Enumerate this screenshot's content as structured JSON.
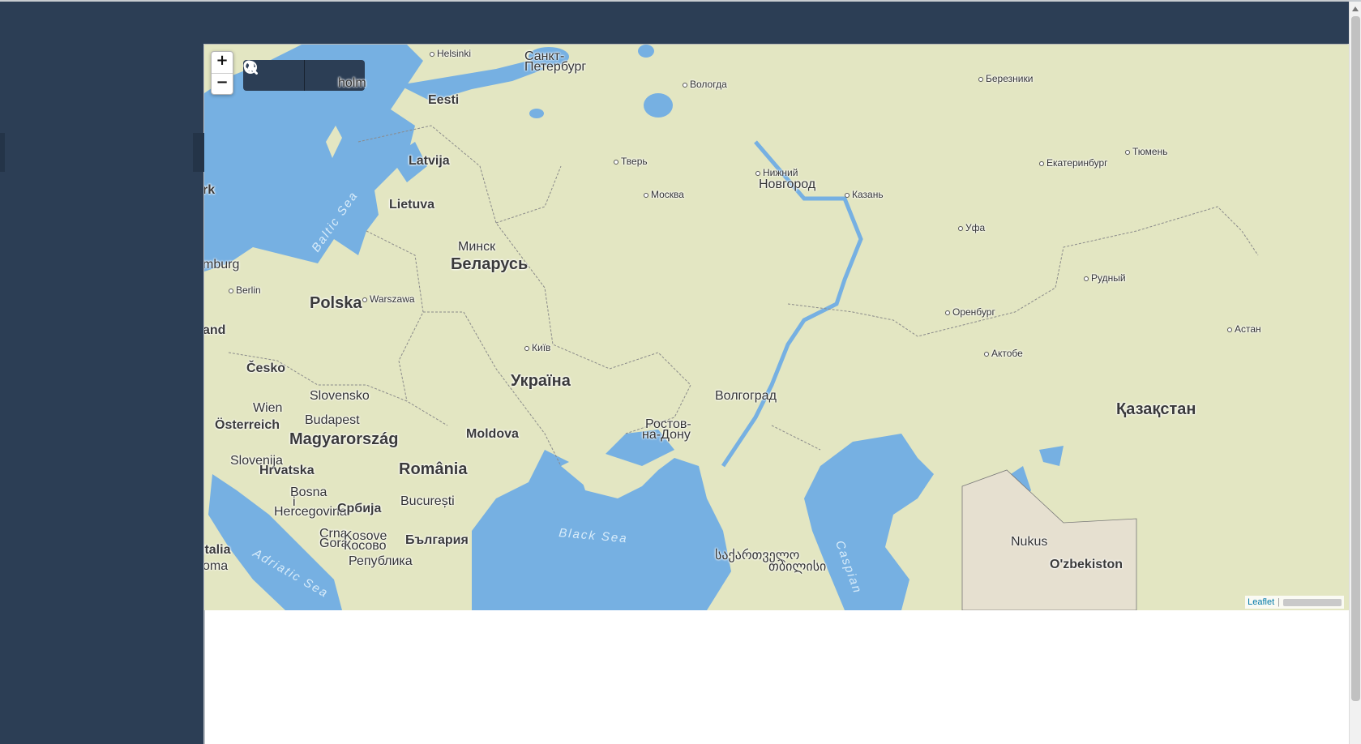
{
  "zoom": {
    "in_label": "+",
    "out_label": "−"
  },
  "toolbar": {
    "globe_icon": "globe-icon",
    "search_icon": "search-icon"
  },
  "attribution": {
    "link": "Leaflet",
    "separator": "|"
  },
  "colors": {
    "chrome": "#2c3e55",
    "water": "#76b0e2",
    "land": "#e3e6c2"
  },
  "map_labels": [
    {
      "text": "Helsinki",
      "kind": "city"
    },
    {
      "text": "Санкт-",
      "kind": "plain"
    },
    {
      "text": "Петербург",
      "kind": "plain"
    },
    {
      "text": "Вологда",
      "kind": "city"
    },
    {
      "text": "Березники",
      "kind": "city"
    },
    {
      "text": "holm",
      "kind": "plain"
    },
    {
      "text": "Eesti",
      "kind": "country"
    },
    {
      "text": "Latvija",
      "kind": "country"
    },
    {
      "text": "Lietuva",
      "kind": "country"
    },
    {
      "text": "rk",
      "kind": "country"
    },
    {
      "text": "mburg",
      "kind": "plain"
    },
    {
      "text": "Berlin",
      "kind": "city"
    },
    {
      "text": "Polska",
      "kind": "country"
    },
    {
      "text": "Warszawa",
      "kind": "city"
    },
    {
      "text": "Минск",
      "kind": "plain"
    },
    {
      "text": "Беларусь",
      "kind": "country"
    },
    {
      "text": "Тверь",
      "kind": "city"
    },
    {
      "text": "Москва",
      "kind": "city"
    },
    {
      "text": "Нижний",
      "kind": "city"
    },
    {
      "text": "Новгород",
      "kind": "plain"
    },
    {
      "text": "Казань",
      "kind": "city"
    },
    {
      "text": "Екатеринбург",
      "kind": "city"
    },
    {
      "text": "Тюмень",
      "kind": "city"
    },
    {
      "text": "Уфа",
      "kind": "city"
    },
    {
      "text": "Рудный",
      "kind": "city"
    },
    {
      "text": "Оренбург",
      "kind": "city"
    },
    {
      "text": "Астан",
      "kind": "city"
    },
    {
      "text": "Актобе",
      "kind": "city"
    },
    {
      "text": "and",
      "kind": "country"
    },
    {
      "text": "Česko",
      "kind": "country"
    },
    {
      "text": "Київ",
      "kind": "city"
    },
    {
      "text": "Україна",
      "kind": "country"
    },
    {
      "text": "Slovensko",
      "kind": "plain"
    },
    {
      "text": "Wien",
      "kind": "plain"
    },
    {
      "text": "Budapest",
      "kind": "plain"
    },
    {
      "text": "Österreich",
      "kind": "country"
    },
    {
      "text": "Magyarország",
      "kind": "country"
    },
    {
      "text": "Moldova",
      "kind": "country"
    },
    {
      "text": "Волгоград",
      "kind": "plain"
    },
    {
      "text": "Ростов-",
      "kind": "plain"
    },
    {
      "text": "на-Дону",
      "kind": "plain"
    },
    {
      "text": "Қазақстан",
      "kind": "country"
    },
    {
      "text": "Slovenija",
      "kind": "plain"
    },
    {
      "text": "Hrvatska",
      "kind": "country"
    },
    {
      "text": "România",
      "kind": "country"
    },
    {
      "text": "Bosna",
      "kind": "plain"
    },
    {
      "text": "i",
      "kind": "plain"
    },
    {
      "text": "Hercegovina",
      "kind": "plain"
    },
    {
      "text": "Србија",
      "kind": "country"
    },
    {
      "text": "București",
      "kind": "plain"
    },
    {
      "text": "Crna",
      "kind": "plain"
    },
    {
      "text": "Gora",
      "kind": "plain"
    },
    {
      "text": "Kosove",
      "kind": "plain"
    },
    {
      "text": "Косово",
      "kind": "plain"
    },
    {
      "text": "България",
      "kind": "country"
    },
    {
      "text": "Република",
      "kind": "plain"
    },
    {
      "text": "Italia",
      "kind": "country"
    },
    {
      "text": "oma",
      "kind": "plain"
    },
    {
      "text": "Baltic Sea",
      "kind": "sea"
    },
    {
      "text": "Adriatic Sea",
      "kind": "sea"
    },
    {
      "text": "Black Sea",
      "kind": "sea"
    },
    {
      "text": "Caspian",
      "kind": "sea"
    },
    {
      "text": "საქართველო",
      "kind": "plain"
    },
    {
      "text": "თბილისი",
      "kind": "plain"
    },
    {
      "text": "Nukus",
      "kind": "plain"
    },
    {
      "text": "O'zbekiston",
      "kind": "country"
    }
  ]
}
